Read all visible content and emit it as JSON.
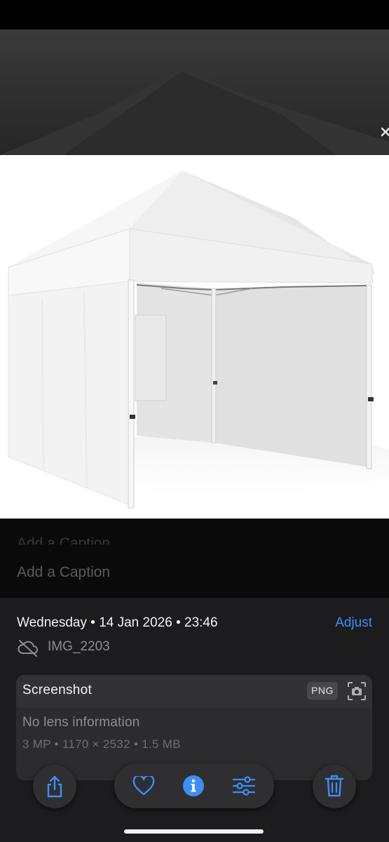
{
  "caption": {
    "ghost_text": "Add a Caption",
    "placeholder": "Add a Caption"
  },
  "info": {
    "date": "Wednesday • 14 Jan 2026 • 23:46",
    "adjust_label": "Adjust",
    "filename": "IMG_2203",
    "source": "Screenshot",
    "format_badge": "PNG",
    "lens": "No lens information",
    "specs": "3 MP • 1170 × 2532 • 1.5 MB"
  },
  "toolbar": {
    "icons": [
      "share-icon",
      "heart-icon",
      "info-icon",
      "adjust-sliders-icon",
      "trash-icon"
    ]
  },
  "colors": {
    "accent": "#3d8ef7",
    "panel_bg": "#1c1c1e",
    "card_bg": "#2c2c2e"
  }
}
